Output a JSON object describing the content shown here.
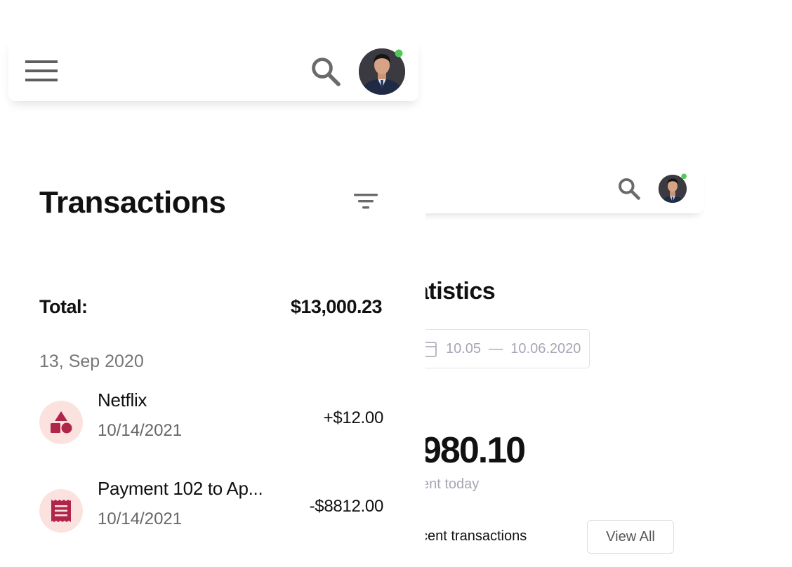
{
  "left_screen": {
    "header": {
      "menu_icon": "hamburger-menu-icon",
      "search_icon": "search-icon",
      "avatar_status": "online",
      "status_color": "#55c85a"
    },
    "page_title": "Transactions",
    "filter_icon": "filter-icon",
    "total": {
      "label": "Total:",
      "value": "$13,000.23"
    },
    "date_group": "13, Sep 2020",
    "transactions": [
      {
        "name": "Netflix",
        "date": "10/14/2021",
        "amount": "+$12.00",
        "icon": "shapes-icon"
      },
      {
        "name": "Payment 102 to Ap...",
        "date": "10/14/2021",
        "amount": "-$8812.00",
        "icon": "receipt-icon"
      }
    ],
    "icon_bg_color": "#fce2df",
    "icon_color": "#b0264a"
  },
  "right_screen": {
    "search_icon": "search-icon",
    "title_partial": "atistics",
    "date_range": {
      "icon": "calendar-icon",
      "text": "10.05  —  10.06.2020"
    },
    "amount_partial": "980.10",
    "amount_caption_partial": "ent today",
    "recent_title_partial": "cent transactions",
    "view_all_label": "View All"
  }
}
